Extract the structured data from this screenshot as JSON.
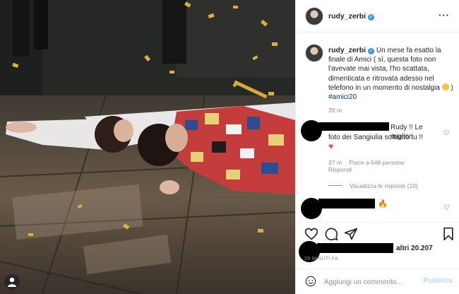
{
  "post": {
    "username": "rudy_zerbi",
    "verified_icon": "verified-badge-icon",
    "more_icon": "more-options-icon"
  },
  "caption": {
    "username": "rudy_zerbi",
    "text": " Un mese fa esatto la finale di Amici ( sì, questa foto non l'avevate mai vista, l'ho scattata, dimenticata e ritrovata adesso nel telefono in un momento di nostalgia ",
    "emoji": "smiling-face-emoji",
    "closing": " ) ",
    "hashtag": "#amici20",
    "time": "39 m"
  },
  "comments": [
    {
      "text_part1": "Rudy !! Le migliori",
      "text_part2": "foto dei Sangiulia soltanto tu !!",
      "emoji": "♥",
      "time": "37 m",
      "likes": "Piace a 648 persone",
      "reply": "Rispondi",
      "view_replies": "Visualizza le risposte (10)"
    },
    {
      "emoji": "🔥"
    }
  ],
  "actions": {
    "like": "heart-icon",
    "comment": "comment-icon",
    "share": "share-icon",
    "save": "bookmark-icon"
  },
  "likes": {
    "text": "altri 20.207"
  },
  "post_time": "39 MINUTI FA",
  "add_comment": {
    "placeholder": "Aggiungi un commento...",
    "publish_label": "Pubblica"
  },
  "colors": {
    "accent": "#3897f0",
    "publish_disabled": "#b2dffc",
    "heart_red": "#ed4956",
    "hashtag": "#00376b"
  }
}
